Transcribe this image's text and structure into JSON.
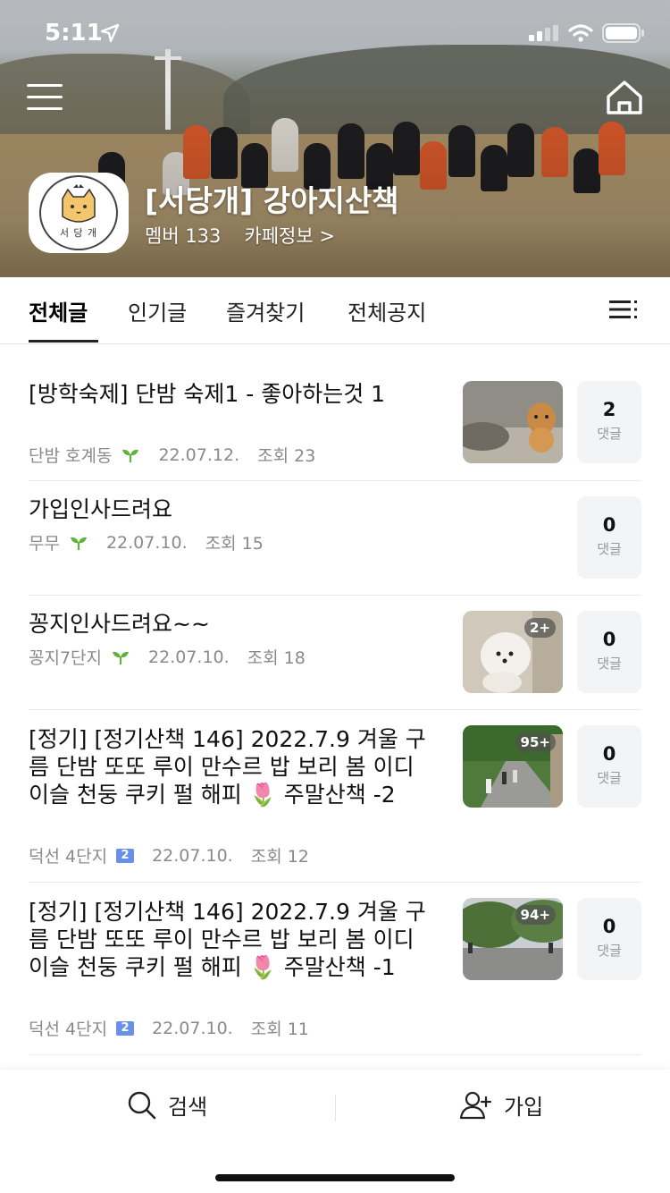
{
  "status_bar": {
    "time": "5:11"
  },
  "cafe": {
    "name": "[서당개] 강아지산책",
    "members": "멤버 133",
    "info_link": "카페정보 >",
    "logo_text": "서 당 개"
  },
  "tabs": [
    {
      "label": "전체글",
      "active": true
    },
    {
      "label": "인기글",
      "active": false
    },
    {
      "label": "즐겨찾기",
      "active": false
    },
    {
      "label": "전체공지",
      "active": false
    }
  ],
  "posts": [
    {
      "title": "[방학숙제] 단밤 숙제1 - 좋아하는것 1",
      "author": "단밤 호계동",
      "badge": "sprout",
      "date": "22.07.12.",
      "views": "조회 23",
      "comments": "2",
      "comment_label": "댓글",
      "has_thumb": true,
      "thumb_count": ""
    },
    {
      "title": "가입인사드려요",
      "author": "무무",
      "badge": "sprout",
      "date": "22.07.10.",
      "views": "조회 15",
      "comments": "0",
      "comment_label": "댓글",
      "has_thumb": false,
      "thumb_count": ""
    },
    {
      "title": "꽁지인사드려요~~",
      "author": "꽁지7단지",
      "badge": "sprout",
      "date": "22.07.10.",
      "views": "조회 18",
      "comments": "0",
      "comment_label": "댓글",
      "has_thumb": true,
      "thumb_count": "2+"
    },
    {
      "title": "[정기] [정기산책 146] 2022.7.9 겨울 구름 단밤 또또 루이 만수르 밥 보리 봄 이디 이슬 천둥 쿠키 펄 해피 🌷 주말산책 -2",
      "author": "덕선 4단지",
      "badge": "2",
      "date": "22.07.10.",
      "views": "조회 12",
      "comments": "0",
      "comment_label": "댓글",
      "has_thumb": true,
      "thumb_count": "95+"
    },
    {
      "title": "[정기] [정기산책 146] 2022.7.9 겨울 구름 단밤 또또 루이 만수르 밥 보리 봄 이디 이슬 천둥 쿠키 펄 해피 🌷 주말산책 -1",
      "author": "덕선 4단지",
      "badge": "2",
      "date": "22.07.10.",
      "views": "조회 11",
      "comments": "0",
      "comment_label": "댓글",
      "has_thumb": true,
      "thumb_count": "94+"
    }
  ],
  "bottom_bar": {
    "search_label": "검색",
    "join_label": "가입"
  },
  "colors": {
    "accent_green": "#5fb33a",
    "level_badge": "#6b8fe6",
    "comment_box": "#f3f4f6"
  }
}
